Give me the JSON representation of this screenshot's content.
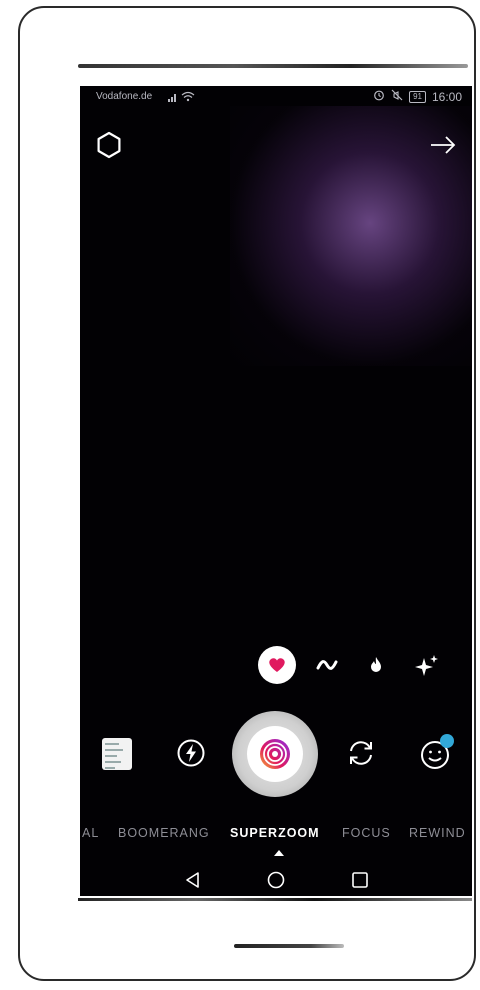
{
  "status_bar": {
    "carrier": "Vodafone.de",
    "battery": "91",
    "time": "16:00"
  },
  "top_bar": {
    "settings_icon": "settings-hexagon-icon",
    "forward_icon": "arrow-right-icon"
  },
  "effects": [
    {
      "name": "heart",
      "selected": true
    },
    {
      "name": "wave"
    },
    {
      "name": "fire"
    },
    {
      "name": "sparkle"
    }
  ],
  "capture_modes": [
    {
      "label": "AL"
    },
    {
      "label": "BOOMERANG"
    },
    {
      "label": "SUPERZOOM",
      "active": true
    },
    {
      "label": "FOCUS"
    },
    {
      "label": "REWIND"
    }
  ],
  "colors": {
    "accent_heart": "#e0195f",
    "notification_dot": "#32a8d8",
    "background": "#020104"
  }
}
